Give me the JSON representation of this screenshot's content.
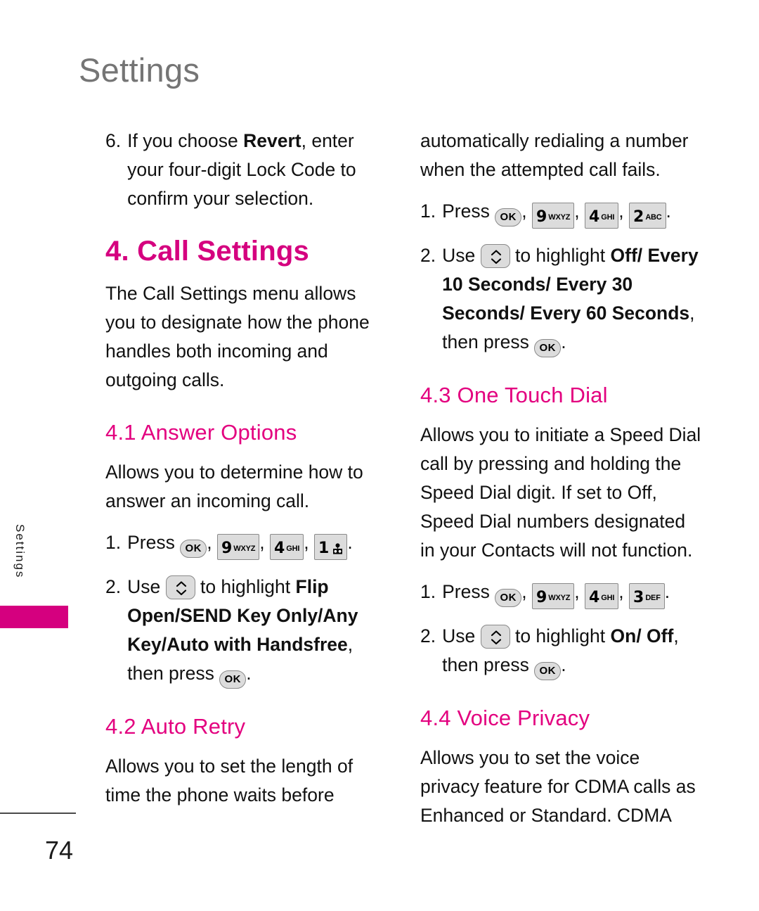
{
  "page": {
    "header_title": "Settings",
    "side_tab_label": "Settings",
    "page_number": "74",
    "accent_color": "#d5007f",
    "header_color": "#757575"
  },
  "keys": {
    "ok": "OK",
    "nine": {
      "digit": "9",
      "letters": "WXYZ"
    },
    "four": {
      "digit": "4",
      "letters": "GHI"
    },
    "one": {
      "digit": "1",
      "letters": "",
      "icon": "voicemail-icon"
    },
    "two": {
      "digit": "2",
      "letters": "ABC"
    },
    "three": {
      "digit": "3",
      "letters": "DEF"
    },
    "nav": "nav-up-down-key"
  },
  "left_column": {
    "step6": {
      "num": "6.",
      "part1": "If you choose ",
      "bold1": "Revert",
      "part2": ", enter your four-digit Lock Code to confirm your selection."
    },
    "section4": {
      "heading": "4. Call Settings",
      "body": "The Call Settings menu allows you to designate how the phone handles both incoming and outgoing calls."
    },
    "section41": {
      "heading": "4.1 Answer Options",
      "body": "Allows you to determine how to answer an incoming call.",
      "step1_num": "1.",
      "step1_prefix": "Press ",
      "step1_sep": ", ",
      "step1_end": ".",
      "step2_num": "2.",
      "step2_prefix": "Use ",
      "step2_mid": " to highlight ",
      "step2_bold": "Flip Open/SEND Key Only/Any Key/Auto with Handsfree",
      "step2_comma": ", ",
      "step2_then": "then press ",
      "step2_end": "."
    },
    "section42": {
      "heading": "4.2 Auto Retry",
      "body": "Allows you to set the length of time the phone waits before"
    }
  },
  "right_column": {
    "continued": "automatically redialing a number when the attempted call fails.",
    "section42_steps": {
      "step1_num": "1.",
      "step1_prefix": "Press ",
      "step1_sep": ", ",
      "step1_end": ".",
      "step2_num": "2.",
      "step2_prefix": "Use ",
      "step2_mid": " to highlight ",
      "step2_bold": "Off/ Every 10 Seconds/ Every 30 Seconds/ Every 60 Seconds",
      "step2_comma": ", ",
      "step2_then": "then press ",
      "step2_end": "."
    },
    "section43": {
      "heading": "4.3 One Touch Dial",
      "body": "Allows you to initiate a Speed Dial call by pressing and holding the Speed Dial digit. If set to Off, Speed Dial numbers designated in your Contacts will not function.",
      "step1_num": "1.",
      "step1_prefix": "Press ",
      "step1_sep": ", ",
      "step1_end": ".",
      "step2_num": "2.",
      "step2_prefix": "Use ",
      "step2_mid": " to highlight ",
      "step2_bold": "On/ Off",
      "step2_comma": ", ",
      "step2_then": "then press ",
      "step2_end": "."
    },
    "section44": {
      "heading": "4.4 Voice Privacy",
      "body": "Allows you to set the voice privacy feature for CDMA calls as Enhanced or Standard. CDMA"
    }
  }
}
